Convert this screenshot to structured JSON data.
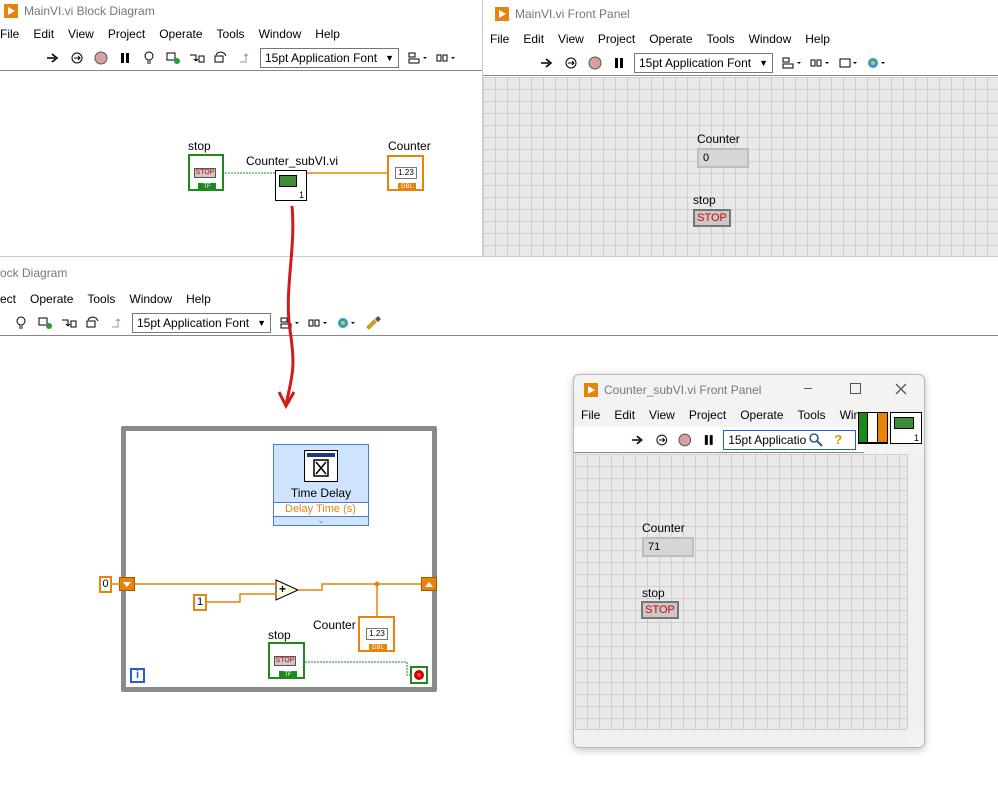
{
  "main_bd": {
    "title": "MainVI.vi Block Diagram",
    "menu": [
      "File",
      "Edit",
      "View",
      "Project",
      "Operate",
      "Tools",
      "Window",
      "Help"
    ],
    "font": "15pt Application Font",
    "stop_label": "stop",
    "subvi_label": "Counter_subVI.vi",
    "counter_label": "Counter",
    "stop_text": "STOP",
    "tf_text": "TF",
    "dbl_text": "DBL",
    "num_glyph": "1.23",
    "connector_num": "1"
  },
  "main_fp": {
    "title": "MainVI.vi Front Panel",
    "menu": [
      "File",
      "Edit",
      "View",
      "Project",
      "Operate",
      "Tools",
      "Window",
      "Help"
    ],
    "font": "15pt Application Font",
    "counter_label": "Counter",
    "counter_value": "0",
    "stop_label": "stop",
    "stop_text": "STOP"
  },
  "sub_bd": {
    "title": "ock Diagram",
    "menu": [
      "ect",
      "Operate",
      "Tools",
      "Window",
      "Help"
    ],
    "font": "15pt Application Font",
    "time_delay_title": "Time Delay",
    "time_delay_param": "Delay Time (s)",
    "init_value": "0",
    "increment_value": "1",
    "plus_glyph": "+",
    "counter_label": "Counter",
    "stop_label": "stop",
    "stop_text": "STOP",
    "tf_text": "TF",
    "dbl_text": "DBL",
    "num_glyph": "1.23",
    "iter_glyph": "i"
  },
  "sub_fp": {
    "title": "Counter_subVI.vi Front Panel",
    "menu": [
      "File",
      "Edit",
      "View",
      "Project",
      "Operate",
      "Tools",
      "Win"
    ],
    "font": "15pt Applicatio",
    "counter_label": "Counter",
    "counter_value": "71",
    "stop_label": "stop",
    "stop_text": "STOP",
    "connector_num": "1",
    "help_glyph": "?"
  },
  "colors": {
    "orange": "#e8830c",
    "green": "#1d8a1d",
    "blue": "#2a5bd7",
    "arrow_red": "#d11a1a",
    "loop_gray": "#777777"
  }
}
